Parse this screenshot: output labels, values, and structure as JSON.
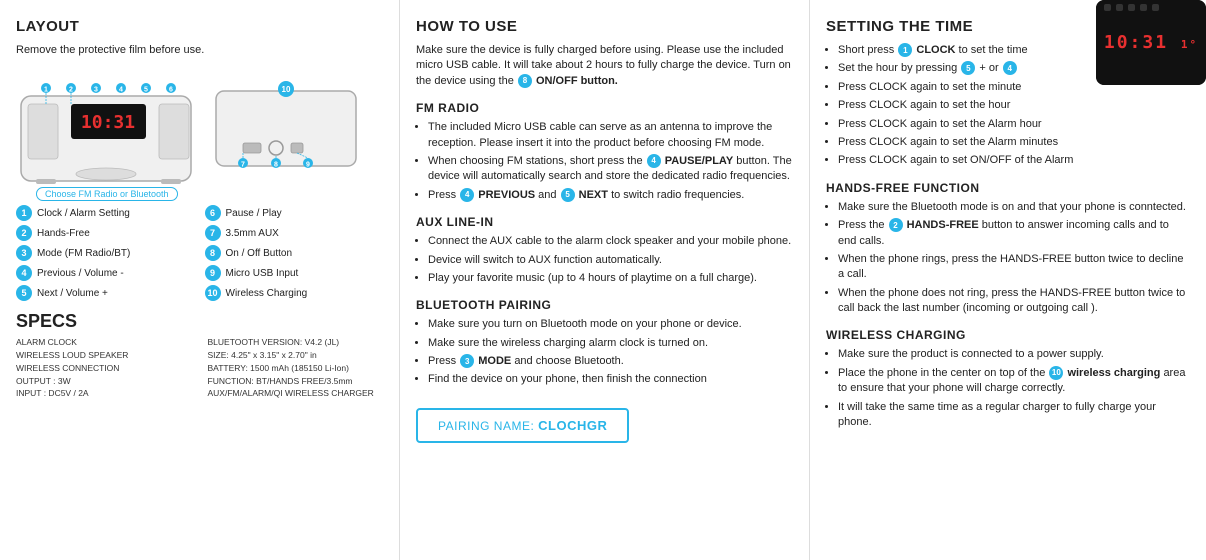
{
  "left": {
    "title": "LAYOUT",
    "subtitle": "Remove the protective film before use.",
    "button_label": "Choose FM Radio or Bluetooth",
    "legend": [
      {
        "num": "1",
        "label": "Clock / Alarm Setting"
      },
      {
        "num": "6",
        "label": "Pause / Play"
      },
      {
        "num": "2",
        "label": "Hands-Free"
      },
      {
        "num": "7",
        "label": "3.5mm AUX"
      },
      {
        "num": "3",
        "label": "Mode (FM Radio/BT)"
      },
      {
        "num": "8",
        "label": "On / Off Button"
      },
      {
        "num": "4",
        "label": "Previous / Volume -"
      },
      {
        "num": "9",
        "label": "Micro USB Input"
      },
      {
        "num": "5",
        "label": "Next / Volume +"
      },
      {
        "num": "10",
        "label": "Wireless Charging"
      }
    ],
    "specs_title": "SPECS",
    "specs_left": [
      "ALARM CLOCK",
      "WIRELESS LOUD SPEAKER",
      "WIRELESS CONNECTION",
      "OUTPUT : 3W",
      "INPUT : DC5V / 2A"
    ],
    "specs_right": [
      "BLUETOOTH VERSION: V4.2 (JL)",
      "SIZE: 4.25\" x 3.15\" x 2.70\" in",
      "BATTERY: 1500 mAh (185150 Li-Ion)",
      "FUNCTION: BT/HANDS FREE/3.5mm",
      "AUX/FM/ALARM/QI WIRELESS CHARGER"
    ]
  },
  "middle": {
    "title": "HOW TO USE",
    "intro": "Make sure the device is fully charged before using. Please use the included micro USB cable. It will take about 2 hours to fully charge the device. Turn on the device using the",
    "intro_badge": "8",
    "intro_end": "ON/OFF button.",
    "fm_radio_title": "FM RADIO",
    "fm_bullets": [
      "The included Micro USB cable can serve as an antenna to improve the reception. Please insert it into the product before choosing FM mode.",
      "When choosing FM stations, short press the",
      "device will automatically search and store the dedicated radio frequencies.",
      "Press"
    ],
    "fm_bullet2_badge": "4",
    "fm_bullet2_btn": "PAUSE/PLAY",
    "fm_bullet2_end": "button. The",
    "fm_bullet3_prefix": "Press",
    "fm_prev_badge": "4",
    "fm_prev_label": "PREVIOUS",
    "fm_next_badge": "5",
    "fm_next_label": "NEXT",
    "fm_next_end": "to switch radio frequencies.",
    "aux_title": "AUX LINE-IN",
    "aux_bullets": [
      "Connect the AUX cable to the alarm clock speaker and your mobile phone.",
      "Device will switch to AUX function automatically.",
      "Play your favorite music (up to 4 hours of playtime on a full charge)."
    ],
    "bt_title": "BLUETOOTH PAIRING",
    "bt_bullets": [
      "Make sure you turn on Bluetooth mode on your phone or device.",
      "Make sure the wireless charging alarm clock is turned on.",
      "Press",
      "Find the device on your phone, then finish the connection"
    ],
    "bt_bullet3_badge": "3",
    "bt_bullet3_btn": "MODE",
    "bt_bullet3_end": "and choose Bluetooth.",
    "pairing_prefix": "PAIRING NAME:",
    "pairing_name": "CLOCHGR"
  },
  "right": {
    "setting_title": "SETTING THE TIME",
    "setting_bullets": [
      {
        "prefix": "Short press",
        "badge": "1",
        "btn": "CLOCK",
        "end": "to set the time"
      },
      {
        "prefix": "Set the hour by pressing",
        "badge1": "5",
        "sep": "+ or",
        "badge2": "4"
      },
      {
        "prefix": "Press CLOCK again to set the minute",
        "badge": null
      },
      {
        "prefix": "Press CLOCK again to set the hour",
        "badge": null
      },
      {
        "prefix": "Press CLOCK again to set the Alarm hour",
        "badge": null
      },
      {
        "prefix": "Press CLOCK again to set the Alarm minutes",
        "badge": null
      },
      {
        "prefix": "Press CLOCK again to set ON/OFF of the Alarm",
        "badge": null
      }
    ],
    "hands_title": "HANDS-FREE FUNCTION",
    "hands_bullets": [
      "Make sure the Bluetooth mode is on and that your phone is conntected.",
      "Press the",
      "When the phone rings, press the HANDS-FREE button twice to decline a call.",
      "When the phone does not ring, press the HANDS-FREE button twice to call back the last number (incoming or outgoing call )."
    ],
    "hands_b2_badge": "2",
    "hands_b2_btn": "HANDS-FREE",
    "hands_b2_end": "button to answer incoming calls and to end calls.",
    "wireless_title": "WIRELESS CHARGING",
    "wireless_bullets": [
      "Make sure the product is connected to a power supply.",
      "Place the phone in the center on top of the",
      "It will take the same time as a regular charger to fully charge your phone."
    ],
    "wireless_b2_badge": "10",
    "wireless_b2_btn": "wireless charging",
    "wireless_b2_end": "area to ensure that your phone will charge correctly.",
    "clock_display": "10:31",
    "clock_extra": "1°"
  }
}
